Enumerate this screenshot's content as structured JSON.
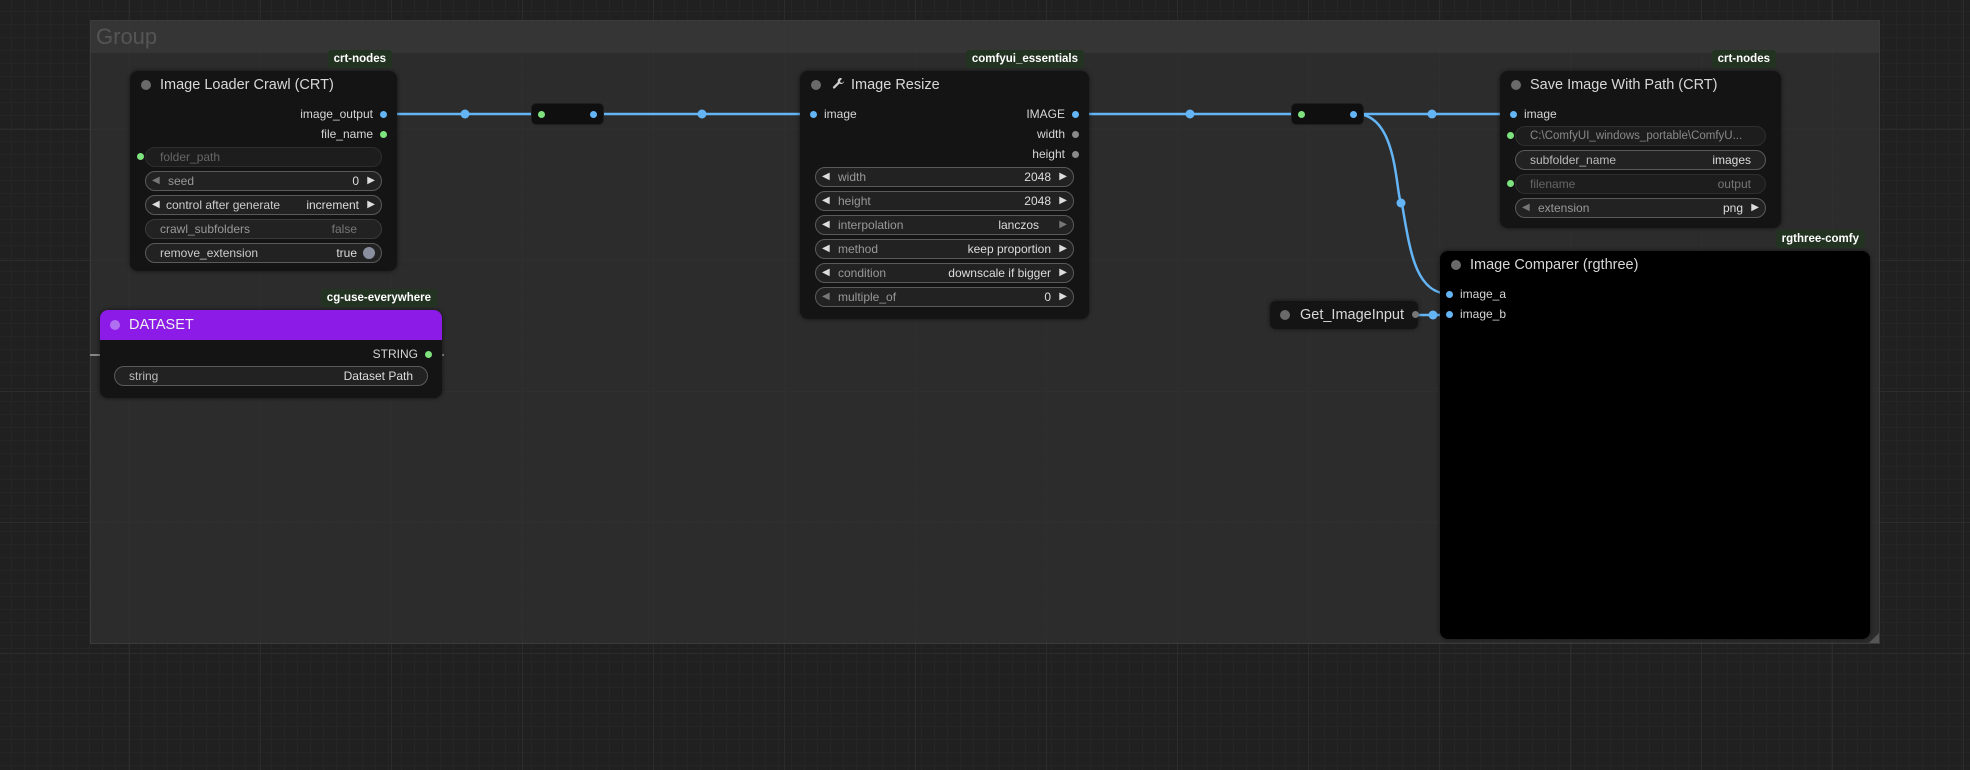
{
  "group": {
    "title": "Group"
  },
  "nodes": {
    "image_loader": {
      "badge": "crt-nodes",
      "title": "Image Loader Crawl (CRT)",
      "outputs": [
        "image_output",
        "file_name"
      ],
      "widgets": {
        "folder_path": {
          "label": "folder_path"
        },
        "seed": {
          "label": "seed",
          "value": "0"
        },
        "control": {
          "label": "control after generate",
          "value": "increment"
        },
        "crawl": {
          "label": "crawl_subfolders",
          "value": "false"
        },
        "remove": {
          "label": "remove_extension",
          "value": "true"
        }
      }
    },
    "dataset": {
      "badge": "cg-use-everywhere",
      "title": "DATASET",
      "output": "STRING",
      "widget": {
        "label": "string",
        "value": "Dataset Path"
      },
      "color": "#8c1be8"
    },
    "resize": {
      "badge": "comfyui_essentials",
      "title": "Image Resize",
      "title_icon": "wrench-icon",
      "input": "image",
      "outputs": [
        "IMAGE",
        "width",
        "height"
      ],
      "widgets": {
        "width": {
          "label": "width",
          "value": "2048"
        },
        "height": {
          "label": "height",
          "value": "2048"
        },
        "interpolation": {
          "label": "interpolation",
          "value": "lanczos"
        },
        "method": {
          "label": "method",
          "value": "keep proportion"
        },
        "condition": {
          "label": "condition",
          "value": "downscale if bigger"
        },
        "multiple": {
          "label": "multiple_of",
          "value": "0"
        }
      }
    },
    "save": {
      "badge": "crt-nodes",
      "title": "Save Image With Path (CRT)",
      "input": "image",
      "widgets": {
        "path": {
          "value": "C:\\ComfyUI_windows_portable\\ComfyU..."
        },
        "subfolder": {
          "label": "subfolder_name",
          "value": "images"
        },
        "filename": {
          "label": "filename",
          "value": "output"
        },
        "extension": {
          "label": "extension",
          "value": "png"
        }
      }
    },
    "get_image": {
      "title": "Get_ImageInput"
    },
    "comparer": {
      "badge": "rgthree-comfy",
      "title": "Image Comparer (rgthree)",
      "inputs": [
        "image_a",
        "image_b"
      ]
    }
  },
  "colors": {
    "link": "#64b5f6",
    "slot_string": "#7ee27e",
    "badge_bg": "#233322"
  }
}
